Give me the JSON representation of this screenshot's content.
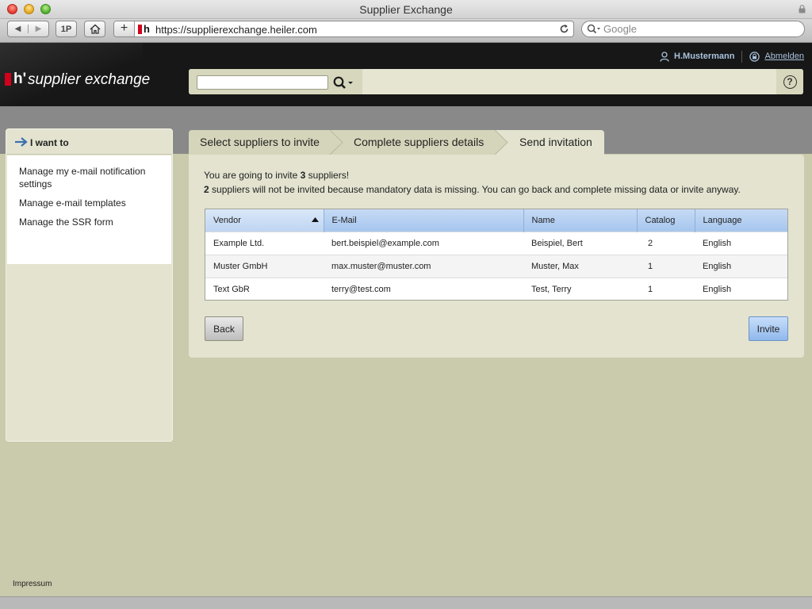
{
  "window": {
    "title": "Supplier Exchange"
  },
  "browser": {
    "url": "https://supplierexchange.heiler.com",
    "search_placeholder": "Google",
    "onepassword_label": "1P"
  },
  "brand": {
    "mark": "h'",
    "name": "supplier exchange"
  },
  "header": {
    "user_name": "H.Mustermann",
    "logout_label": "Abmelden",
    "search_value": "",
    "help_label": "?"
  },
  "sidebar": {
    "title": "I want to",
    "items": [
      {
        "label": "Manage my e-mail notification settings"
      },
      {
        "label": "Manage e-mail templates"
      },
      {
        "label": "Manage the SSR form"
      }
    ]
  },
  "wizard": {
    "steps": [
      {
        "label": "Select suppliers to invite"
      },
      {
        "label": "Complete suppliers details"
      },
      {
        "label": "Send invitation"
      }
    ],
    "active_step": 3
  },
  "message": {
    "line1_pre": "You are going to invite ",
    "line1_count": "3",
    "line1_post": " suppliers!",
    "line2_count": "2",
    "line2_post": " suppliers will not be invited because mandatory data is missing. You can go back and complete missing data or invite anyway."
  },
  "table": {
    "columns": [
      "Vendor",
      "E-Mail",
      "Name",
      "Catalog",
      "Language"
    ],
    "sort_column": "Vendor",
    "sort_direction": "ascending",
    "rows": [
      [
        "Example Ltd.",
        "bert.beispiel@example.com",
        "Beispiel, Bert",
        "2",
        "English"
      ],
      [
        "Muster GmbH",
        "max.muster@muster.com",
        "Muster, Max",
        "1",
        "English"
      ],
      [
        "Text GbR",
        "terry@test.com",
        "Test, Terry",
        "1",
        "English"
      ]
    ]
  },
  "buttons": {
    "back": "Back",
    "invite": "Invite"
  },
  "footer": {
    "impressum": "Impressum"
  },
  "colors": {
    "header_bg": "#171717",
    "brand_red": "#d2001a",
    "panel_bg": "#e3e3d0",
    "page_bg": "#cacaac",
    "grid_header_blue": "#a6c6ee",
    "link_blue": "#a9c1dd"
  },
  "icons": {
    "user": "user-icon",
    "logout": "lock-icon",
    "search": "magnifier-icon",
    "help": "help-icon",
    "sidebar_arrow": "arrow-right-icon",
    "sort": "sort-ascending-icon"
  }
}
